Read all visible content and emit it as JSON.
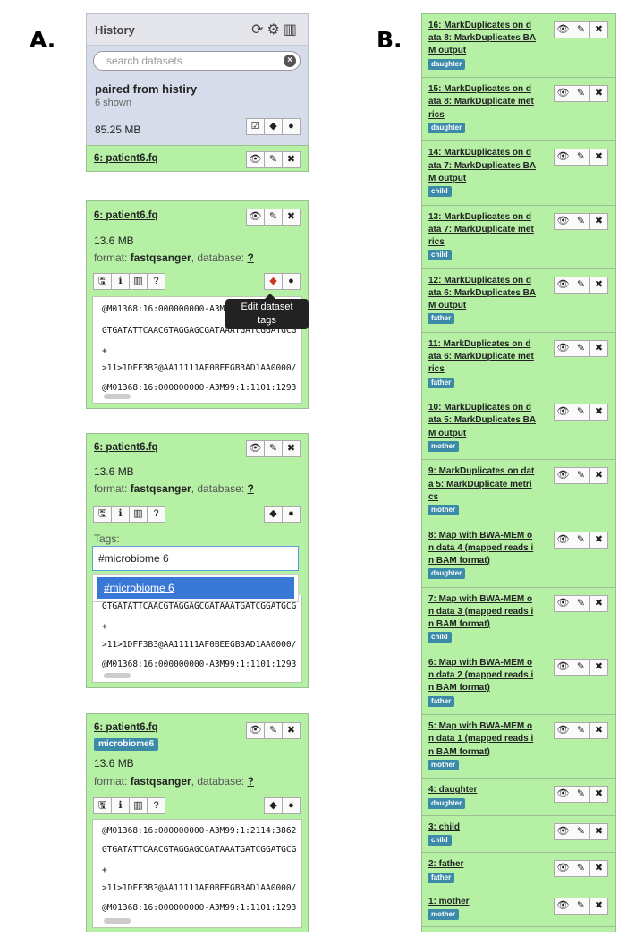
{
  "figure_labels": {
    "a": "A.",
    "b": "B."
  },
  "history": {
    "title": "History",
    "header_icons": [
      "refresh-icon",
      "gear-icon",
      "columns-icon"
    ],
    "search_placeholder": "search datasets",
    "name": "paired from histiry",
    "shown": "6 shown",
    "size": "85.25 MB"
  },
  "dataset": {
    "title": "6: patient6.fq",
    "size": "13.6 MB",
    "format_label": "format:",
    "format_value": "fastqsanger",
    "database_label": ", database:",
    "database_value": "?"
  },
  "tooltip": {
    "line1": "Edit dataset",
    "line2": "tags"
  },
  "tags_label": "Tags:",
  "tag_input_value": "#microbiome 6",
  "tag_suggestion": "#microbiome 6",
  "tag_badge": "microbiome6",
  "peek_lines": [
    "@M01368:16:000000000-A3M99:1:2114:3862",
    "GTGATATTCAACGTAGGAGCGATAAATGATCGGATGCG",
    "+",
    ">11>1DFF3B3@AA11111AF0BEEGB3AD1AA0000/",
    "@M01368:16:000000000-A3M99:1:1101:1293"
  ],
  "peek_short": "@M01368:16:000000000-A3M9",
  "right_rows": [
    {
      "title": "16: MarkDuplicates on data 8: MarkDuplicates BAM output",
      "tag": "daughter"
    },
    {
      "title": "15: MarkDuplicates on data 8: MarkDuplicate metrics",
      "tag": "daughter"
    },
    {
      "title": "14: MarkDuplicates on data 7: MarkDuplicates BAM output",
      "tag": "child"
    },
    {
      "title": "13: MarkDuplicates on data 7: MarkDuplicate metrics",
      "tag": "child"
    },
    {
      "title": "12: MarkDuplicates on data 6: MarkDuplicates BAM output",
      "tag": "father"
    },
    {
      "title": "11: MarkDuplicates on data 6: MarkDuplicate metrics",
      "tag": "father"
    },
    {
      "title": "10: MarkDuplicates on data 5: MarkDuplicates BAM output",
      "tag": "mother"
    },
    {
      "title": "9: MarkDuplicates on data 5: MarkDuplicate metrics",
      "tag": "mother"
    },
    {
      "title": "8: Map with BWA-MEM on data 4 (mapped reads in BAM format)",
      "tag": "daughter"
    },
    {
      "title": "7: Map with BWA-MEM on data 3 (mapped reads in BAM format)",
      "tag": "child"
    },
    {
      "title": "6: Map with BWA-MEM on data 2 (mapped reads in BAM format)",
      "tag": "father"
    },
    {
      "title": "5: Map with BWA-MEM on data 1 (mapped reads in BAM format)",
      "tag": "mother"
    },
    {
      "title": "4: daughter",
      "tag": "daughter"
    },
    {
      "title": "3: child",
      "tag": "child"
    },
    {
      "title": "2: father",
      "tag": "father"
    },
    {
      "title": "1: mother",
      "tag": "mother"
    }
  ],
  "right_row_lines": [
    [
      "16: MarkDuplicates on d",
      "ata 8: MarkDuplicates BA",
      "M output"
    ],
    [
      "15: MarkDuplicates on d",
      "ata 8: MarkDuplicate met",
      "rics"
    ],
    [
      "14: MarkDuplicates on d",
      "ata 7: MarkDuplicates BA",
      "M output"
    ],
    [
      "13: MarkDuplicates on d",
      "ata 7: MarkDuplicate met",
      "rics"
    ],
    [
      "12: MarkDuplicates on d",
      "ata 6: MarkDuplicates BA",
      "M output"
    ],
    [
      "11: MarkDuplicates on d",
      "ata 6: MarkDuplicate met",
      "rics"
    ],
    [
      "10: MarkDuplicates on d",
      "ata 5: MarkDuplicates BA",
      "M output"
    ],
    [
      "9: MarkDuplicates on dat",
      "a 5: MarkDuplicate metri",
      "cs"
    ],
    [
      "8: Map with BWA-MEM o",
      "n data 4 (mapped reads i",
      "n BAM format)"
    ],
    [
      "7: Map with BWA-MEM o",
      "n data 3 (mapped reads i",
      "n BAM format)"
    ],
    [
      "6: Map with BWA-MEM o",
      "n data 2 (mapped reads i",
      "n BAM format)"
    ],
    [
      "5: Map with BWA-MEM o",
      "n data 1 (mapped reads i",
      "n BAM format)"
    ],
    [
      "4: daughter"
    ],
    [
      "3: child"
    ],
    [
      "2: father"
    ],
    [
      "1: mother"
    ]
  ],
  "colors": {
    "dataset_ok": "#b5f0a5",
    "history_bg": "#d6dcea",
    "tag_badge": "#3b8aa8",
    "tooltip_bg": "#222222",
    "suggestion_hl": "#3a78d8"
  }
}
